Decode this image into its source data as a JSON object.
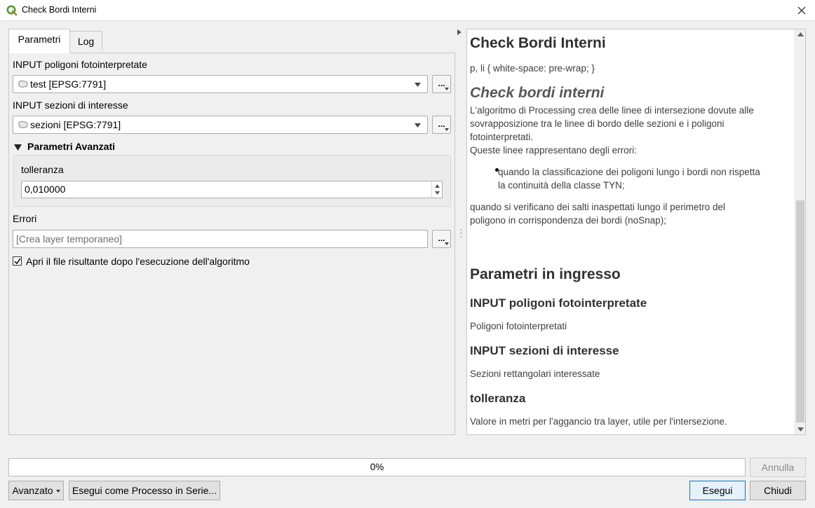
{
  "window": {
    "title": "Check Bordi Interni",
    "icon": "qgis-icon"
  },
  "tabs": [
    {
      "label": "Parametri",
      "active": true
    },
    {
      "label": "Log",
      "active": false
    }
  ],
  "params": {
    "input_poly": {
      "label": "INPUT poligoni fotointerpretate",
      "value": "test [EPSG:7791]",
      "button": "..."
    },
    "input_sections": {
      "label": "INPUT sezioni di interesse",
      "value": "sezioni [EPSG:7791]",
      "button": "..."
    },
    "advanced": {
      "header": "Parametri Avanzati",
      "tolerance_label": "tolleranza",
      "tolerance_value": "0,010000"
    },
    "errors": {
      "label": "Errori",
      "placeholder": "[Crea layer temporaneo]",
      "button": "..."
    },
    "open_file": {
      "label": "Apri il file risultante dopo l'esecuzione dell'algoritmo",
      "checked": true
    }
  },
  "help": {
    "title": "Check Bordi Interni",
    "css_note": "p, li { white-space: pre-wrap; }",
    "subtitle": "Check bordi interni",
    "desc_lines": [
      "L'algoritmo di Processing crea delle linee di intersezione dovute alle",
      "sovrapposizione tra le linee di bordo delle sezioni e i poligoni",
      "fotointerpretati.",
      "Queste linee rappresentano degli errori:"
    ],
    "bullet_lines": [
      "quando la classificazione dei poligoni lungo i bordi non rispetta",
      "la continuità della classe TYN;"
    ],
    "after_lines": [
      "quando si verificano dei salti inaspettati lungo il perimetro del",
      "poligono in corrispondenza dei bordi (noSnap);"
    ],
    "params_title": "Parametri in ingresso",
    "p1_title": "INPUT poligoni fotointerpretate",
    "p1_desc": "Poligoni fotointerpretati",
    "p2_title": "INPUT sezioni di interesse",
    "p2_desc": "Sezioni rettangolari interessate",
    "p3_title": "tolleranza",
    "p3_desc": "Valore in metri per l'aggancio tra layer, utile per l'intersezione."
  },
  "footer": {
    "progress": "0%",
    "cancel": "Annulla",
    "advanced": "Avanzato",
    "batch": "Esegui come Processo in Serie...",
    "run": "Esegui",
    "close": "Chiudi"
  },
  "colors": {
    "accent": "#0078d7",
    "help_text": "#3e3e3e",
    "qgis_green": "#589632",
    "qgis_yellow": "#ee7913"
  }
}
